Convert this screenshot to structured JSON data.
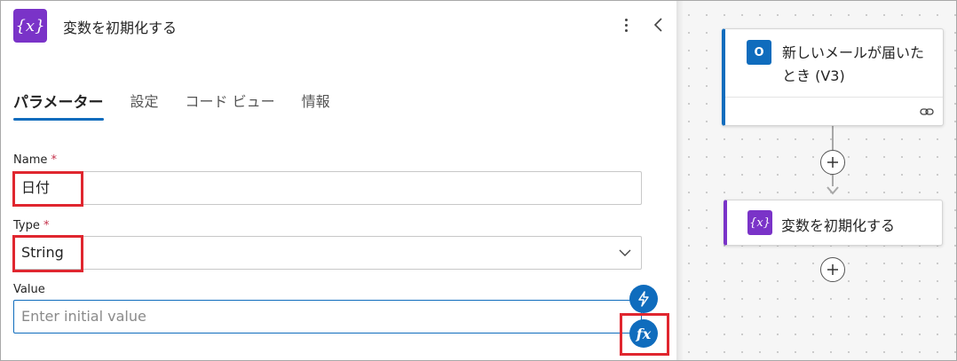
{
  "panel": {
    "title": "変数を初期化する",
    "icon_text": "{x}",
    "more_icon": "more-vertical-icon",
    "collapse_icon": "chevron-left-icon"
  },
  "tabs": [
    {
      "label": "パラメーター",
      "active": true
    },
    {
      "label": "設定",
      "active": false
    },
    {
      "label": "コード ビュー",
      "active": false
    },
    {
      "label": "情報",
      "active": false
    }
  ],
  "fields": {
    "name": {
      "label": "Name",
      "required_mark": "*",
      "value": "日付"
    },
    "type": {
      "label": "Type",
      "required_mark": "*",
      "value": "String"
    },
    "value": {
      "label": "Value",
      "placeholder": "Enter initial value"
    }
  },
  "side_buttons": {
    "dynamic_content_icon": "lightning-icon",
    "expression_label": "fx"
  },
  "canvas": {
    "trigger_card": {
      "icon_text": "O",
      "title": "新しいメールが届いたとき (V3)",
      "link_icon": "link-icon"
    },
    "action_card": {
      "icon_text": "{x}",
      "title": "変数を初期化する"
    }
  },
  "colors": {
    "accent": "#0f6cbd",
    "variable_purple": "#7a33c8",
    "highlight_red": "#e0262f",
    "required_red": "#c4314b"
  }
}
